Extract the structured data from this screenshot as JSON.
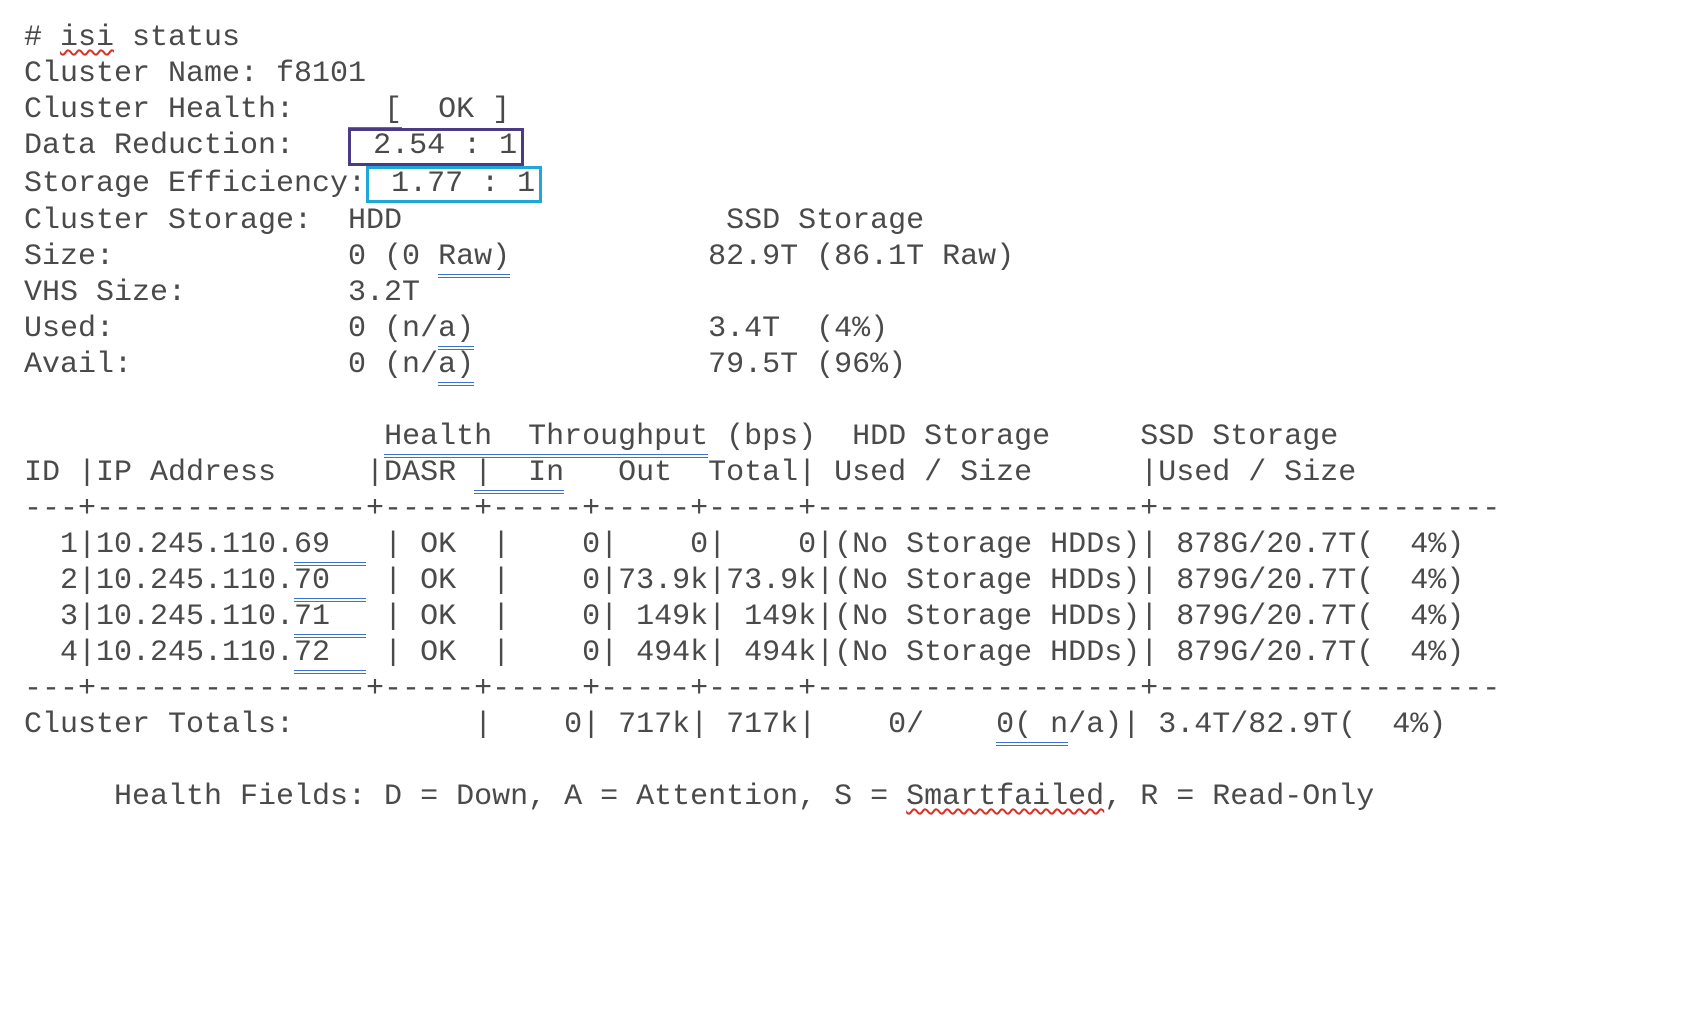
{
  "prompt": "# ",
  "cmd_part1": "isi",
  "cmd_part2": " status",
  "cluster_name_label": "Cluster Name: ",
  "cluster_name_value": "f8101",
  "cluster_health_label": "Cluster Health:   ",
  "cluster_health_value_pre": "  [",
  "cluster_health_value_mid": "  OK ]",
  "data_reduction_label": "Data Reduction:   ",
  "data_reduction_value": " 2.54 : 1",
  "storage_eff_label": "Storage Efficiency:",
  "storage_eff_value": " 1.77 : 1",
  "cluster_storage_line": "Cluster Storage:  HDD                  SSD Storage",
  "size_label": "Size:             0 (0 ",
  "size_raw": "Raw)",
  "size_gap": "           ",
  "size_ssd": "82.9T (86.1T Raw)",
  "vhs_line": "VHS Size:         3.2T",
  "used_label": "Used:             0 (n/",
  "used_a": "a)",
  "used_gap": "             ",
  "used_ssd": "3.4T  (4%)",
  "avail_label": "Avail:            0 (n/",
  "avail_a": "a)",
  "avail_gap": "             ",
  "avail_ssd": "79.5T (96%)",
  "hdr1_a": "                    ",
  "hdr1_b": "Health  Throughput",
  "hdr1_c": " (bps)  HDD Storage     SSD Storage",
  "hdr2_a": "ID |IP Address     |DASR ",
  "hdr2_b": "|  In",
  "hdr2_c": "   Out  Total| Used / Size      |Used / Size",
  "sep1": "---+---------------+-----+-----+-----+-----+------------------+-------------------",
  "rows": {
    "r1a": "  1|10.245.110.",
    "r1b": "69  ",
    "r1c": " |",
    "r1d": " OK  |    0|    0|    0|(No Storage HDDs)| 878G/20.7T(  4%)",
    "r2a": "  2|10.245.110.",
    "r2b": "70  ",
    "r2c": " |",
    "r2d": " OK  |    0|73.9k|73.9k|(No Storage HDDs)| 879G/20.7T(  4%)",
    "r3a": "  3|10.245.110.",
    "r3b": "71  ",
    "r3c": " |",
    "r3d": " OK  |    0| 149k| 149k|(No Storage HDDs)| 879G/20.7T(  4%)",
    "r4a": "  4|10.245.110.",
    "r4b": "72  ",
    "r4c": " |",
    "r4d": " OK  |    0| 494k| 494k|(No Storage HDDs)| 879G/20.7T(  4%)"
  },
  "sep2": "---+---------------+-----+-----+-----+-----+------------------+-------------------",
  "totals_a": "Cluster Totals:          |    0| 717k| 717k|    0/    ",
  "totals_b": "0( n",
  "totals_c": "/a)| 3.4T/82.9T(  4%)",
  "legend_a": "     Health Fields: D = Down, A = Attention, S = ",
  "legend_b": "Smartfailed",
  "legend_c": ", R = Read-Only"
}
